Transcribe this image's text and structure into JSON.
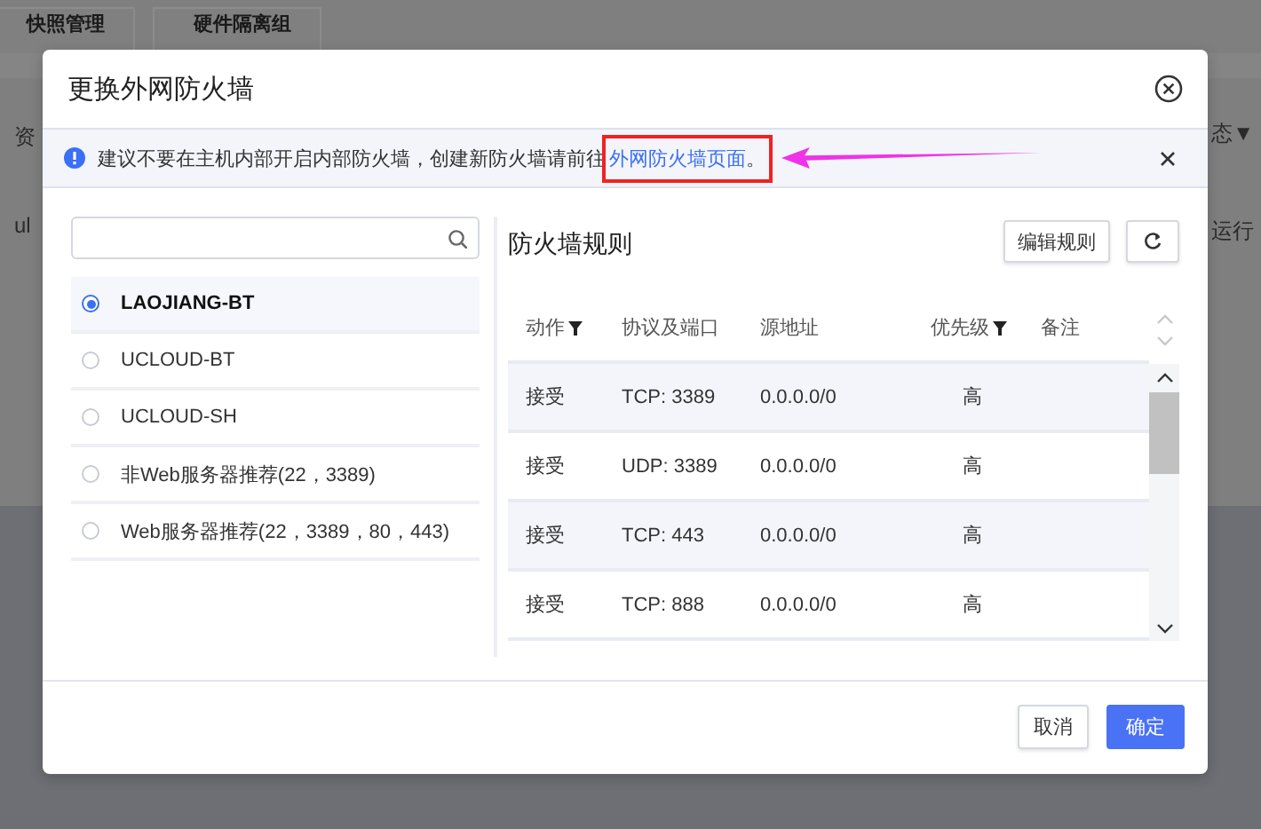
{
  "background": {
    "tabs": [
      "快照管理",
      "硬件隔离组"
    ],
    "left_texts": [
      "资",
      "ul"
    ],
    "right_texts": [
      "态▼",
      "运行"
    ]
  },
  "dialog": {
    "title": "更换外网防火墙",
    "alert": {
      "text": "建议不要在主机内部开启内部防火墙，创建新防火墙请前往",
      "link": "外网防火墙页面",
      "tail": "。"
    },
    "templates": [
      {
        "name": "LAOJIANG-BT",
        "selected": true
      },
      {
        "name": "UCLOUD-BT",
        "selected": false
      },
      {
        "name": "UCLOUD-SH",
        "selected": false
      },
      {
        "name": "非Web服务器推荐(22，3389)",
        "selected": false
      },
      {
        "name": "Web服务器推荐(22，3389，80，443)",
        "selected": false
      }
    ],
    "rules_title": "防火墙规则",
    "edit_button": "编辑规则",
    "columns": [
      {
        "label": "动作",
        "filter": true
      },
      {
        "label": "协议及端口",
        "filter": false
      },
      {
        "label": "源地址",
        "filter": false
      },
      {
        "label": "优先级",
        "filter": true
      },
      {
        "label": "备注",
        "filter": false
      }
    ],
    "rows": [
      {
        "action": "接受",
        "protocol": "TCP: 3389",
        "source": "0.0.0.0/0",
        "priority": "高"
      },
      {
        "action": "接受",
        "protocol": "UDP: 3389",
        "source": "0.0.0.0/0",
        "priority": "高"
      },
      {
        "action": "接受",
        "protocol": "TCP: 443",
        "source": "0.0.0.0/0",
        "priority": "高"
      },
      {
        "action": "接受",
        "protocol": "TCP: 888",
        "source": "0.0.0.0/0",
        "priority": "高"
      }
    ],
    "buttons": [
      {
        "label": "取消",
        "kind": "secondary"
      },
      {
        "label": "确定",
        "kind": "primary"
      }
    ]
  }
}
